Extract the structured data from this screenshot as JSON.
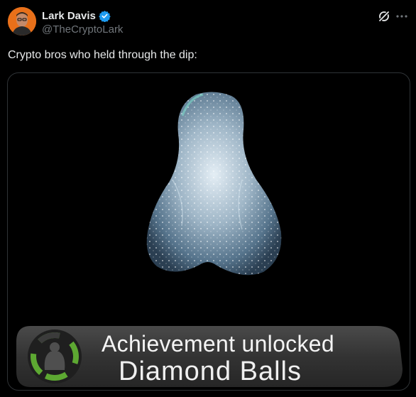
{
  "author": {
    "name": "Lark Davis",
    "handle": "@TheCryptoLark",
    "verified": true
  },
  "icons": {
    "verified": "verified-badge-icon",
    "grok": "grok-icon",
    "more": "more-options-icon"
  },
  "tweet": {
    "text": "Crypto bros who held through the dip:"
  },
  "media": {
    "achievement_title": "Achievement unlocked",
    "achievement_name": "Diamond Balls"
  },
  "colors": {
    "background": "#000000",
    "text": "#e7e9ea",
    "muted": "#71767b",
    "verified": "#1d9bf0",
    "achievement_ring": "#5da832"
  }
}
